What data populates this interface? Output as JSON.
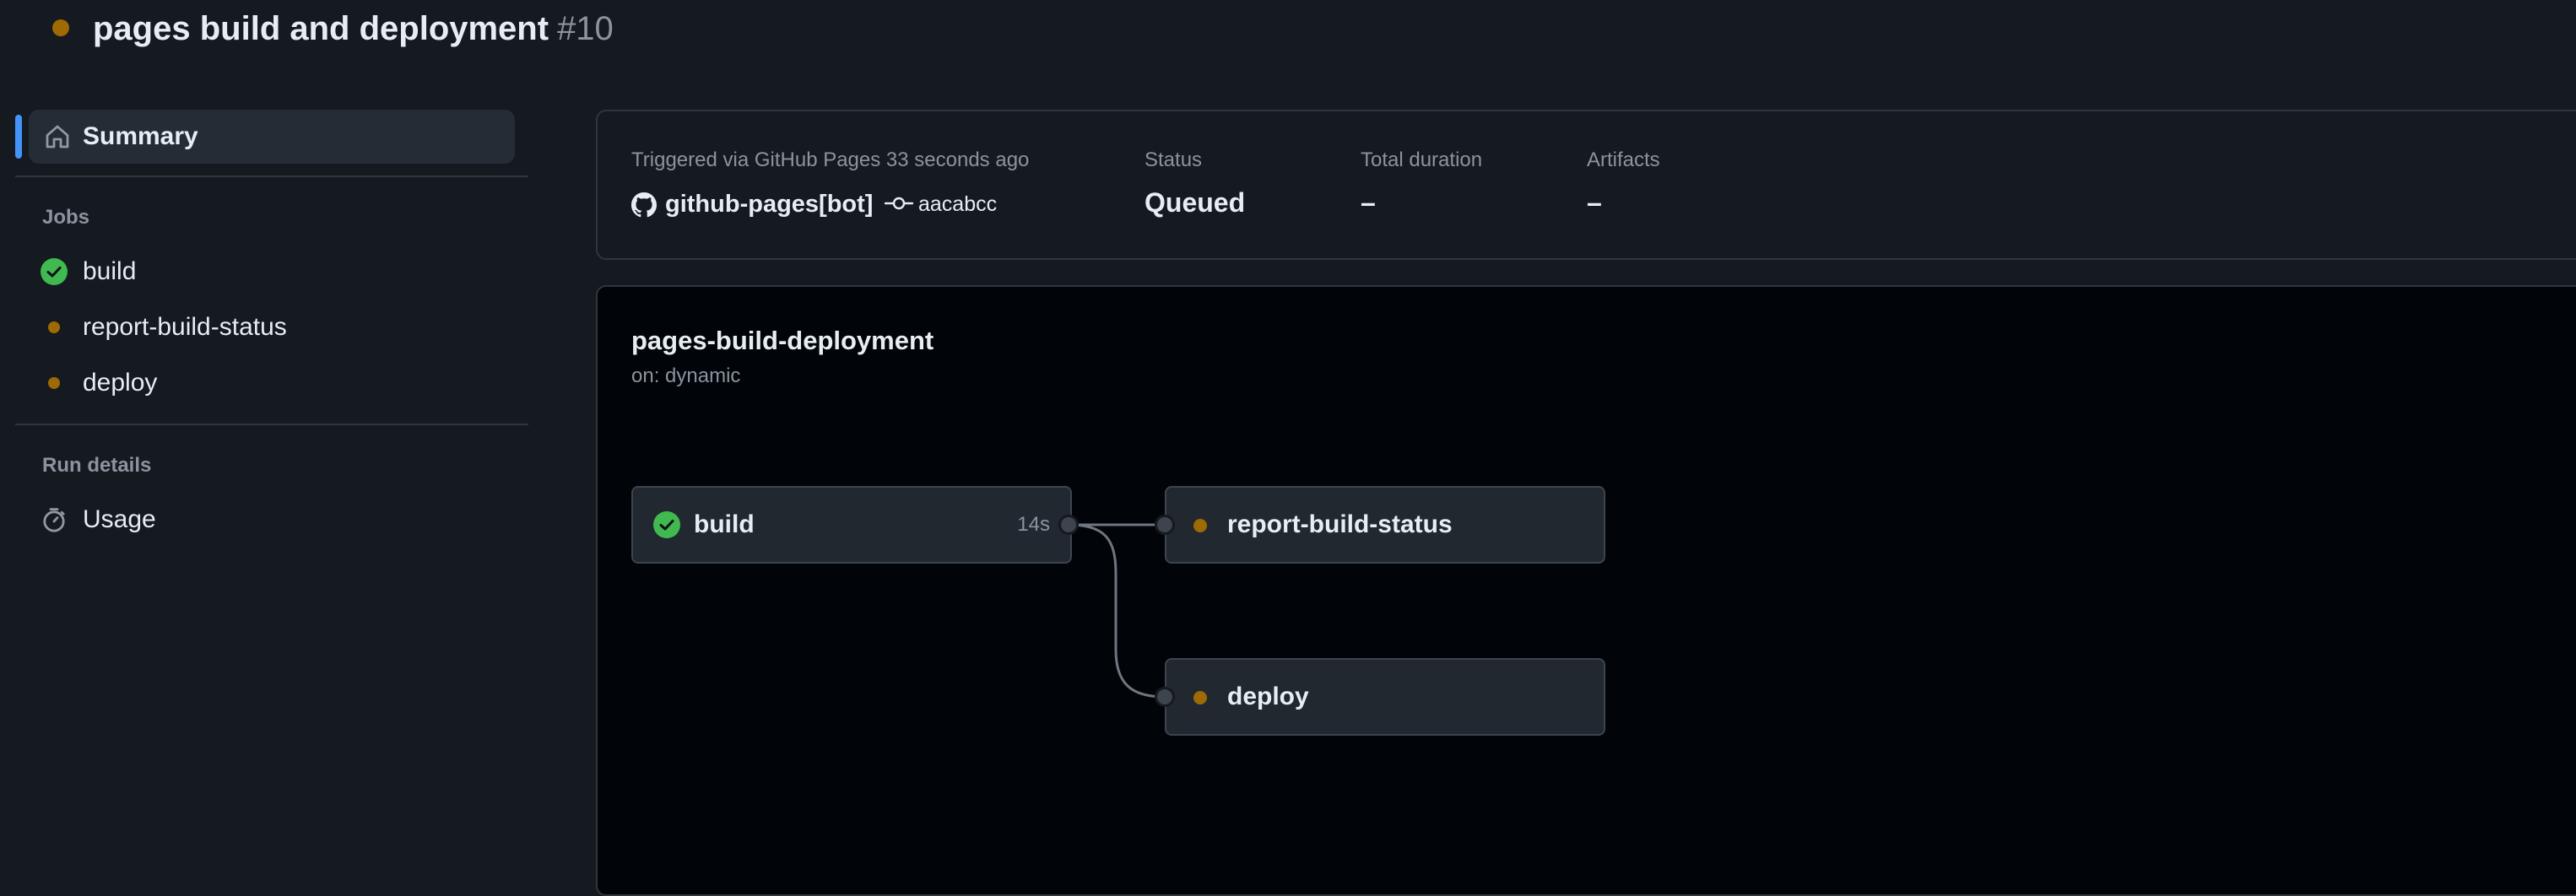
{
  "header": {
    "title": "pages build and deployment",
    "run_number": "#10"
  },
  "sidebar": {
    "summary_label": "Summary",
    "jobs_heading": "Jobs",
    "jobs": [
      {
        "label": "build",
        "status": "success"
      },
      {
        "label": "report-build-status",
        "status": "queued"
      },
      {
        "label": "deploy",
        "status": "queued"
      }
    ],
    "run_details_heading": "Run details",
    "usage_label": "Usage"
  },
  "summary": {
    "triggered_text": "Triggered via GitHub Pages 33 seconds ago",
    "actor": "github-pages[bot]",
    "commit": "aacabcc",
    "status_label": "Status",
    "status_value": "Queued",
    "duration_label": "Total duration",
    "duration_value": "–",
    "artifacts_label": "Artifacts",
    "artifacts_value": "–"
  },
  "workflow": {
    "name": "pages-build-deployment",
    "trigger": "on: dynamic",
    "jobs": [
      {
        "label": "build",
        "duration": "14s",
        "status": "success"
      },
      {
        "label": "report-build-status",
        "status": "queued"
      },
      {
        "label": "deploy",
        "status": "queued"
      }
    ]
  },
  "colors": {
    "queued": "#9e6a03",
    "success": "#3fb950",
    "accent": "#4493f8"
  }
}
